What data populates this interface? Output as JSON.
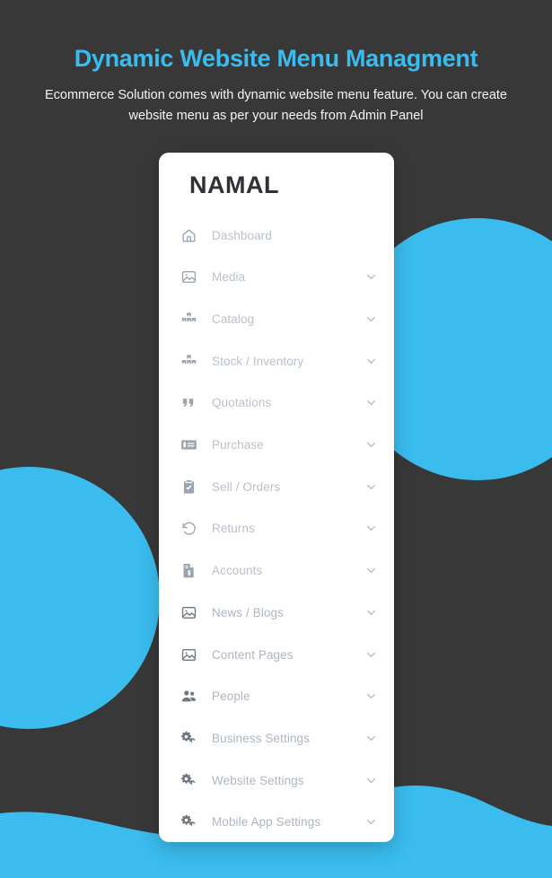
{
  "header": {
    "title": "Dynamic Website Menu Managment",
    "subtitle": "Ecommerce Solution comes with dynamic website menu feature. You can create website menu as per your needs from Admin Panel"
  },
  "theme": {
    "accent": "#3ABCEE",
    "background": "#383838",
    "card_background": "#FFFFFF",
    "menu_text": "#BAC1CA",
    "logo_text": "#2F3136"
  },
  "sidebar": {
    "logo": "NAMAL",
    "items": [
      {
        "label": "Dashboard",
        "icon": "home-icon",
        "expandable": false
      },
      {
        "label": "Media",
        "icon": "image-icon",
        "expandable": true
      },
      {
        "label": "Catalog",
        "icon": "boxes-icon",
        "expandable": true
      },
      {
        "label": "Stock / Inventory",
        "icon": "boxes-icon",
        "expandable": true
      },
      {
        "label": "Quotations",
        "icon": "quote-right-icon",
        "expandable": true
      },
      {
        "label": "Purchase",
        "icon": "money-check-icon",
        "expandable": true
      },
      {
        "label": "Sell / Orders",
        "icon": "clipboard-check-icon",
        "expandable": true
      },
      {
        "label": "Returns",
        "icon": "undo-icon",
        "expandable": true
      },
      {
        "label": "Accounts",
        "icon": "file-invoice-dollar-icon",
        "expandable": true
      },
      {
        "label": "News / Blogs",
        "icon": "image-icon",
        "expandable": true
      },
      {
        "label": "Content Pages",
        "icon": "image-icon",
        "expandable": true
      },
      {
        "label": "People",
        "icon": "users-icon",
        "expandable": true
      },
      {
        "label": "Business Settings",
        "icon": "cogs-icon",
        "expandable": true
      },
      {
        "label": "Website Settings",
        "icon": "cogs-icon",
        "expandable": true
      },
      {
        "label": "Mobile App Settings",
        "icon": "cogs-icon",
        "expandable": true
      }
    ],
    "chevron_icon": "chevron-down-icon"
  },
  "decorations": {
    "circle_right": "decorative-circle",
    "circle_left": "decorative-circle",
    "wave": "decorative-wave"
  }
}
